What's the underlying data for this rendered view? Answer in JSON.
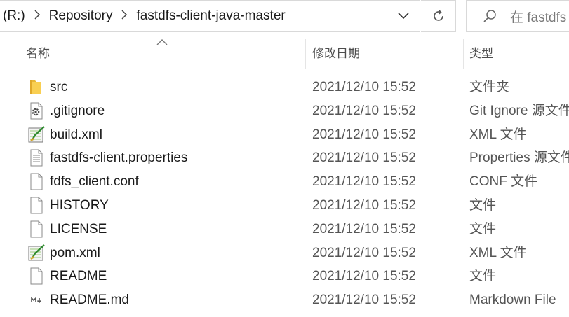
{
  "address": {
    "drive": "(R:)",
    "crumbs": [
      "Repository",
      "fastdfs-client-java-master"
    ]
  },
  "search": {
    "placeholder": "在 fastdfs"
  },
  "columns": {
    "name": "名称",
    "date": "修改日期",
    "type": "类型"
  },
  "files": [
    {
      "icon": "folder-icon",
      "name": "src",
      "date": "2021/12/10 15:52",
      "type": "文件夹"
    },
    {
      "icon": "gear-file-icon",
      "name": ".gitignore",
      "date": "2021/12/10 15:52",
      "type": "Git Ignore 源文件"
    },
    {
      "icon": "xml-file-icon",
      "name": "build.xml",
      "date": "2021/12/10 15:52",
      "type": "XML 文件"
    },
    {
      "icon": "text-file-icon",
      "name": "fastdfs-client.properties",
      "date": "2021/12/10 15:52",
      "type": "Properties 源文件"
    },
    {
      "icon": "blank-file-icon",
      "name": "fdfs_client.conf",
      "date": "2021/12/10 15:52",
      "type": "CONF 文件"
    },
    {
      "icon": "blank-file-icon",
      "name": "HISTORY",
      "date": "2021/12/10 15:52",
      "type": "文件"
    },
    {
      "icon": "blank-file-icon",
      "name": "LICENSE",
      "date": "2021/12/10 15:52",
      "type": "文件"
    },
    {
      "icon": "xml-file-icon",
      "name": "pom.xml",
      "date": "2021/12/10 15:52",
      "type": "XML 文件"
    },
    {
      "icon": "blank-file-icon",
      "name": "README",
      "date": "2021/12/10 15:52",
      "type": "文件"
    },
    {
      "icon": "markdown-file-icon",
      "name": "README.md",
      "date": "2021/12/10 15:52",
      "type": "Markdown File"
    }
  ]
}
